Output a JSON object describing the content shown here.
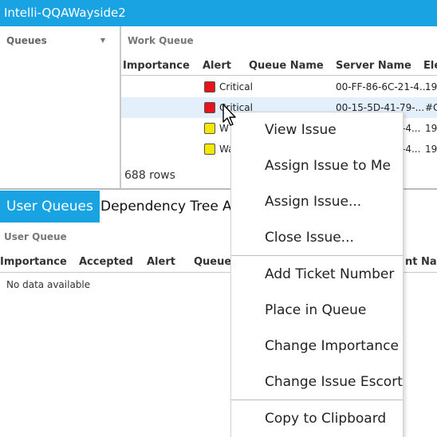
{
  "window": {
    "title": "Intelli-QQAWayside2"
  },
  "queues_panel": {
    "title": "Queues",
    "caret_icon": "caret-down-icon"
  },
  "work_queue": {
    "title": "Work Queue",
    "columns": [
      "Importance",
      "Alert",
      "Queue Name",
      "Server Name",
      "Ele"
    ],
    "rows": [
      {
        "alert_color": "#e8141b",
        "alert_text": "Critical",
        "server": "00-FF-86-6C-21-4...",
        "extra": "19"
      },
      {
        "alert_color": "#e8141b",
        "alert_text": "Critical",
        "server": "00-15-5D-41-79-...",
        "extra": "#C",
        "selected": true
      },
      {
        "alert_color": "#f5e800",
        "alert_text": "W",
        "server": "-4...",
        "extra": "19"
      },
      {
        "alert_color": "#f5e800",
        "alert_text": "Wa",
        "server": "-4...",
        "extra": "19"
      }
    ],
    "row_count": "688 rows"
  },
  "tabs": [
    {
      "label": "User Queues",
      "active": true
    },
    {
      "label": "Dependency Tree",
      "active": false
    },
    {
      "label": "A",
      "active": false
    }
  ],
  "user_queue": {
    "title": "User Queue",
    "columns": [
      "Importance",
      "Accepted",
      "Alert",
      "Queue",
      "nt Nam"
    ],
    "empty_text": "No data available"
  },
  "context_menu": {
    "items": [
      "View Issue",
      "Assign Issue to Me",
      "Assign Issue...",
      "Close Issue...",
      "Add Ticket Number",
      "Place in Queue",
      "Change Importance",
      "Change Issue Escort",
      "Copy to Clipboard"
    ]
  },
  "colors": {
    "accent": "#19a3e3",
    "critical": "#e8141b",
    "warning": "#f5e800"
  }
}
